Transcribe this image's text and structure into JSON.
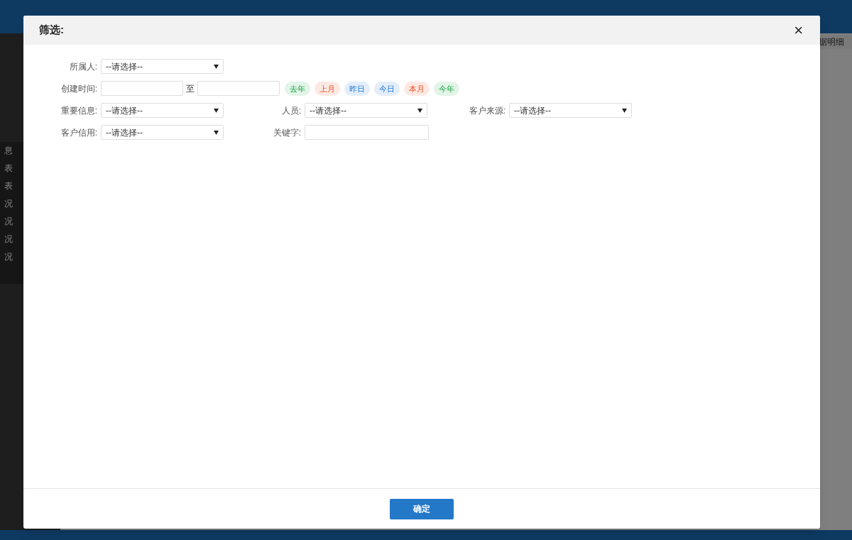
{
  "background": {
    "sidebar_items": [
      "息",
      "表",
      "表",
      "况",
      "况",
      "况",
      "况"
    ],
    "tab_fragment": "据明细"
  },
  "dialog": {
    "title": "筛选:",
    "close": "×",
    "rows": [
      {
        "fields": [
          {
            "kind": "select",
            "label": "所属人:",
            "value": "--请选择--"
          }
        ]
      },
      {
        "fields": [
          {
            "kind": "date_range",
            "label": "创建时间:",
            "separator": "至",
            "shortcuts": [
              {
                "label": "去年",
                "color": "#e3f4e8"
              },
              {
                "label": "上月",
                "color": "#fde9e3"
              },
              {
                "label": "昨日",
                "color": "#e3eefa"
              },
              {
                "label": "今日",
                "color": "#e3eefa"
              },
              {
                "label": "本月",
                "color": "#fde9e3"
              },
              {
                "label": "今年",
                "color": "#e3f4e8"
              }
            ]
          }
        ]
      },
      {
        "fields": [
          {
            "kind": "select",
            "label": "重要信息:",
            "value": "--请选择--"
          },
          {
            "kind": "select",
            "label": "人员:",
            "value": "--请选择--"
          },
          {
            "kind": "select",
            "label": "客户来源:",
            "value": "--请选择--"
          }
        ]
      },
      {
        "fields": [
          {
            "kind": "select",
            "label": "客户信用:",
            "value": "--请选择--"
          },
          {
            "kind": "text",
            "label": "关键字:"
          }
        ]
      }
    ],
    "confirm": "确定"
  }
}
